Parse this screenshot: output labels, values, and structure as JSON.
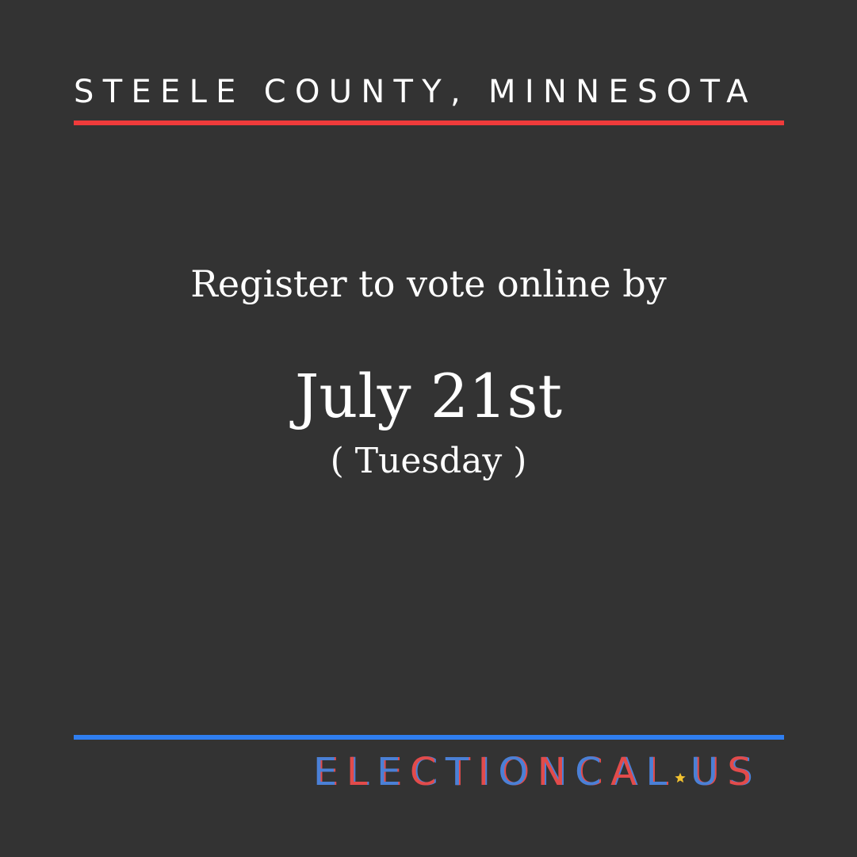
{
  "header": {
    "county": "STEELE COUNTY, MINNESOTA"
  },
  "main": {
    "instruction": "Register to vote online by",
    "date": "July 21st",
    "weekday": "( Tuesday )"
  },
  "footer": {
    "logo_text": "ELECTIONCAL.US",
    "logo_part1": "ELECTIONCAL",
    "logo_part2": "US",
    "logo_icon": "star-icon"
  },
  "colors": {
    "background": "#333333",
    "top_rule": "#ef3b3b",
    "bottom_rule": "#2f7ef0",
    "logo_blue": "#4b80d6",
    "logo_red": "#e24b4b",
    "star": "#f2c230",
    "text": "#ffffff"
  }
}
